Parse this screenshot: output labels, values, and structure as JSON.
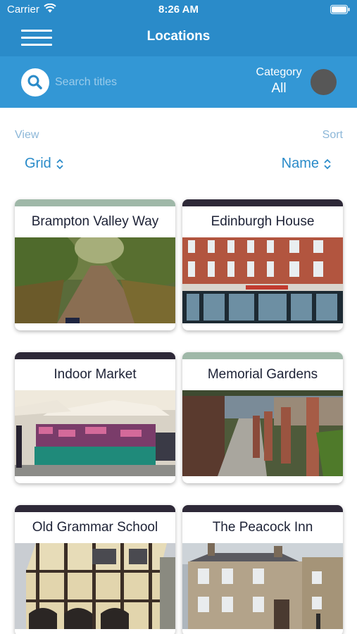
{
  "status": {
    "carrier": "Carrier",
    "time": "8:26 AM"
  },
  "nav": {
    "title": "Locations"
  },
  "search": {
    "placeholder": "Search titles"
  },
  "category": {
    "label": "Category",
    "value": "All"
  },
  "view": {
    "label": "View",
    "value": "Grid"
  },
  "sort": {
    "label": "Sort",
    "value": "Name"
  },
  "colors": {
    "header": "#2a8bc9",
    "search_bar": "#3397d5",
    "stripe_green": "#9fb8a8",
    "stripe_dark": "#2e2938"
  },
  "cards": [
    {
      "title": "Brampton Valley Way",
      "stripe": "#9fb8a8",
      "image": "tree-lined path"
    },
    {
      "title": "Edinburgh House",
      "stripe": "#2e2938",
      "image": "brick building shopfront"
    },
    {
      "title": "Indoor Market",
      "stripe": "#2e2938",
      "image": "market stalls"
    },
    {
      "title": "Memorial Gardens",
      "stripe": "#9fb8a8",
      "image": "garden pergola walkway"
    },
    {
      "title": "Old Grammar School",
      "stripe": "#2e2938",
      "image": "timber framed building"
    },
    {
      "title": "The Peacock Inn",
      "stripe": "#2e2938",
      "image": "stone inn building"
    }
  ]
}
